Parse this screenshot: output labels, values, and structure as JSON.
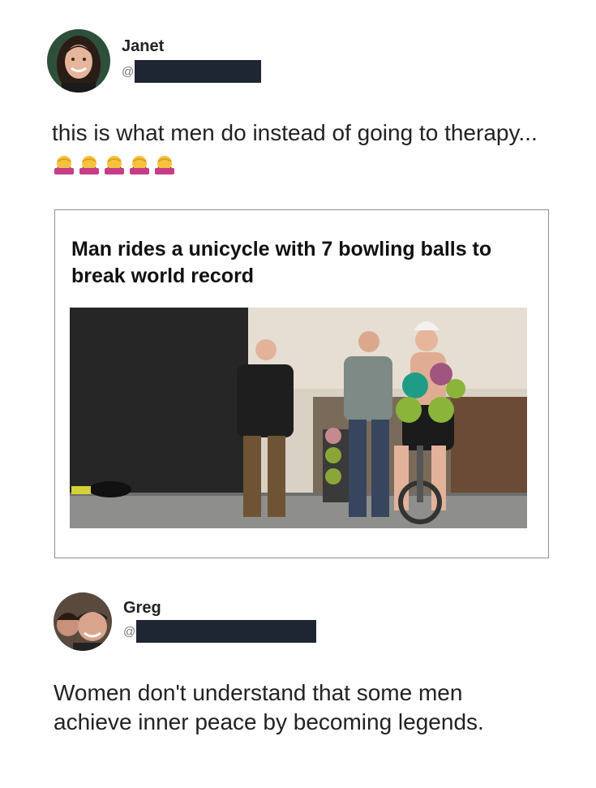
{
  "tweet1": {
    "name": "Janet",
    "handle_prefix": "@",
    "text": "this is what men do instead of going to therapy...",
    "emoji": "woman-facepalming",
    "emoji_count": 5
  },
  "card": {
    "title": "Man rides a unicycle with 7 bowling balls to break world record"
  },
  "tweet2": {
    "name": "Greg",
    "handle_prefix": "@",
    "text": "Women don't understand that some men achieve inner peace by becoming legends."
  },
  "colors": {
    "redaction": "#1e2533",
    "text": "#222222",
    "card_border": "#8f8f8f"
  }
}
